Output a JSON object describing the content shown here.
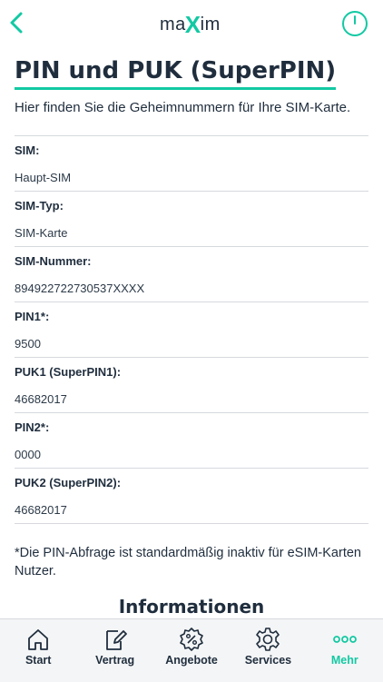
{
  "header": {
    "logo_text_left": "ma",
    "logo_text_x": "X",
    "logo_text_right": "im",
    "back_icon": "chevron-left-icon",
    "power_icon": "power-icon",
    "accent_color": "#12c9a3"
  },
  "page": {
    "title": "PIN und PUK (SuperPIN)",
    "intro": "Hier finden Sie die Geheimnummern für Ihre SIM-Karte."
  },
  "rows": [
    {
      "label": "SIM:",
      "value": "Haupt-SIM"
    },
    {
      "label": "SIM-Typ:",
      "value": "SIM-Karte"
    },
    {
      "label": "SIM-Nummer:",
      "value": "894922722730537XXXX"
    },
    {
      "label": "PIN1*:",
      "value": "9500"
    },
    {
      "label": "PUK1 (SuperPIN1):",
      "value": "46682017"
    },
    {
      "label": "PIN2*:",
      "value": "0000"
    },
    {
      "label": "PUK2 (SuperPIN2):",
      "value": "46682017"
    }
  ],
  "note": "*Die PIN-Abfrage ist standardmäßig inaktiv für eSIM-Karten Nutzer.",
  "section_title": "Informationen",
  "tabs": [
    {
      "label": "Start",
      "icon": "home-icon",
      "active": false
    },
    {
      "label": "Vertrag",
      "icon": "contract-edit-icon",
      "active": false
    },
    {
      "label": "Angebote",
      "icon": "percent-badge-icon",
      "active": false
    },
    {
      "label": "Services",
      "icon": "gear-icon",
      "active": false
    },
    {
      "label": "Mehr",
      "icon": "more-dots-icon",
      "active": true
    }
  ]
}
